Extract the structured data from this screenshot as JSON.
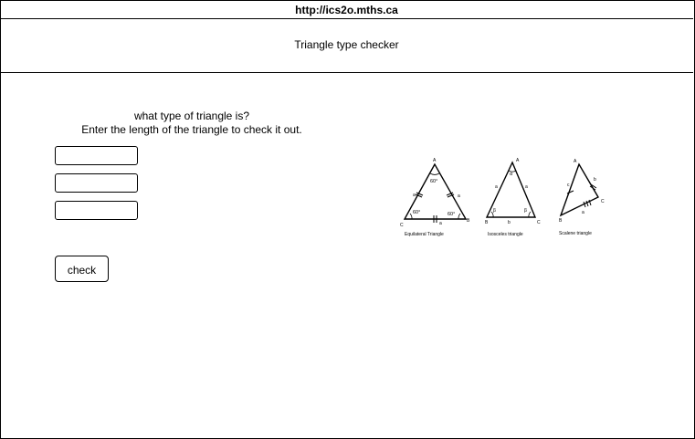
{
  "browser": {
    "url": "http://ics2o.mths.ca"
  },
  "header": {
    "title": "Triangle  type checker"
  },
  "main": {
    "prompt_line1": "what type of triangle is?",
    "prompt_line2": "Enter the length of the triangle to check it out.",
    "inputs": [
      {
        "value": "",
        "placeholder": ""
      },
      {
        "value": "",
        "placeholder": ""
      },
      {
        "value": "",
        "placeholder": ""
      }
    ],
    "check_label": "check"
  },
  "diagram": {
    "equilateral": {
      "caption": "Equilateral Triangle",
      "vertices": [
        "A",
        "B",
        "C"
      ],
      "sides": [
        "a",
        "a",
        "a"
      ],
      "angles": [
        "60°",
        "60°",
        "60°"
      ]
    },
    "isosceles": {
      "caption": "Isosceles triangle",
      "vertices": [
        "A",
        "B",
        "C"
      ],
      "sides": [
        "a",
        "a",
        "b"
      ],
      "angles": [
        "α",
        "β",
        "β"
      ]
    },
    "scalene": {
      "caption": "Scalene triangle",
      "vertices": [
        "A",
        "B",
        "C"
      ],
      "sides": [
        "c",
        "b",
        "a"
      ]
    }
  }
}
